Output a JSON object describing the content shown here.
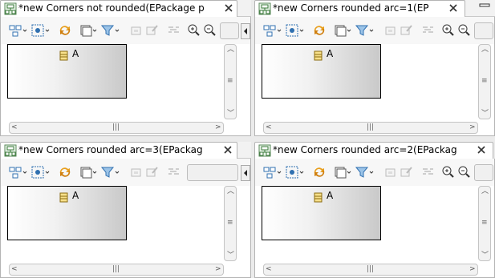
{
  "editors": [
    {
      "id": "not-rounded",
      "title": "*new Corners not rounded(EPackage p",
      "node_label": "A"
    },
    {
      "id": "arc-1",
      "title": "*new Corners rounded arc=1(EP",
      "node_label": "A"
    },
    {
      "id": "arc-3",
      "title": "*new Corners rounded arc=3(EPackag",
      "node_label": "A"
    },
    {
      "id": "arc-2",
      "title": "*new Corners rounded arc=2(EPackag",
      "node_label": "A"
    }
  ],
  "icons": {
    "tab": "diagram-editor-icon",
    "close": "close-icon",
    "node": "eclass-icon",
    "arrange": "arrange-all-icon",
    "select": "select-all-icon",
    "refresh": "refresh-icon",
    "layer": "layers-icon",
    "filter": "filter-icon",
    "zoom_in": "zoom-in-icon",
    "zoom_out": "zoom-out-icon"
  },
  "colors": {
    "tab_bg": "#ffffff",
    "toolbar_bg": "#f7f7f7",
    "window_bg": "#ebebeb",
    "node_border": "#000000"
  },
  "scrollbar": {
    "grip": "|||",
    "grip_v": "≡"
  },
  "view_menu": {
    "label": "view-menu-icon"
  }
}
